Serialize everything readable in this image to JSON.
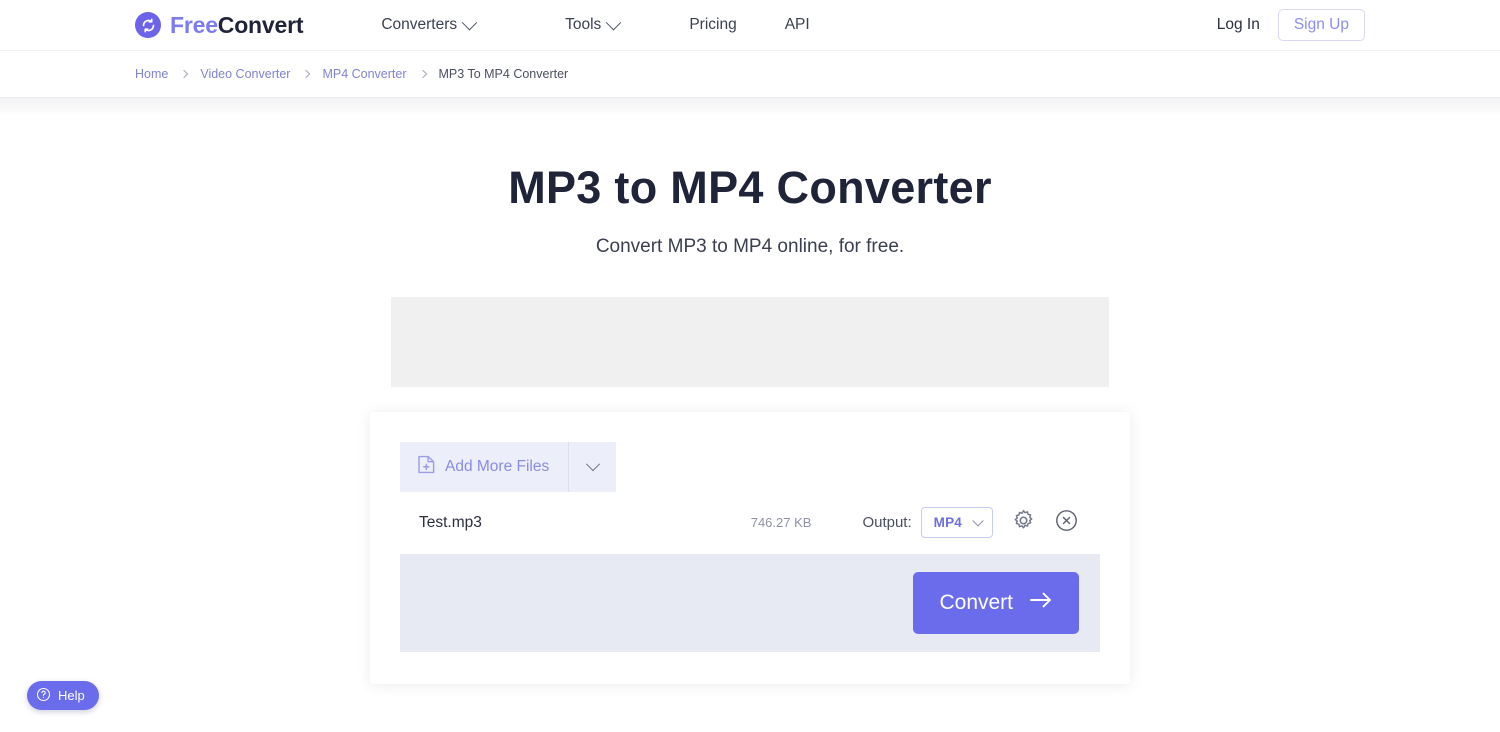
{
  "header": {
    "logo": {
      "icon": "refresh-circle-icon",
      "text_part1": "Free",
      "text_part2": "Convert"
    },
    "nav": [
      {
        "label": "Converters",
        "has_dropdown": true
      },
      {
        "label": "Tools",
        "has_dropdown": true
      },
      {
        "label": "Pricing",
        "has_dropdown": false
      },
      {
        "label": "API",
        "has_dropdown": false
      }
    ],
    "login_label": "Log In",
    "signup_label": "Sign Up"
  },
  "breadcrumb": {
    "items": [
      {
        "label": "Home",
        "current": false
      },
      {
        "label": "Video Converter",
        "current": false
      },
      {
        "label": "MP4 Converter",
        "current": false
      },
      {
        "label": "MP3 To MP4 Converter",
        "current": true
      }
    ]
  },
  "hero": {
    "title": "MP3 to MP4 Converter",
    "subtitle": "Convert MP3 to MP4 online, for free."
  },
  "converter": {
    "add_more_label": "Add More Files",
    "add_more_icon": "file-plus-icon",
    "add_more_dropdown_icon": "chevron-down-icon",
    "file": {
      "name": "Test.mp3",
      "size": "746.27 KB",
      "output_label": "Output:",
      "output_format": "MP4",
      "settings_icon": "gear-icon",
      "remove_icon": "close-circle-icon"
    },
    "convert_label": "Convert",
    "convert_icon": "arrow-right-icon"
  },
  "help": {
    "label": "Help",
    "icon": "question-circle-icon"
  },
  "colors": {
    "accent": "#6a6cec",
    "accent_light": "#8a8cdf",
    "link": "#8183cf",
    "heading": "#202438",
    "footer_bg": "#e7eaf3",
    "addbar_bg": "#eceefa",
    "ad_bg": "#f0f0f1"
  }
}
